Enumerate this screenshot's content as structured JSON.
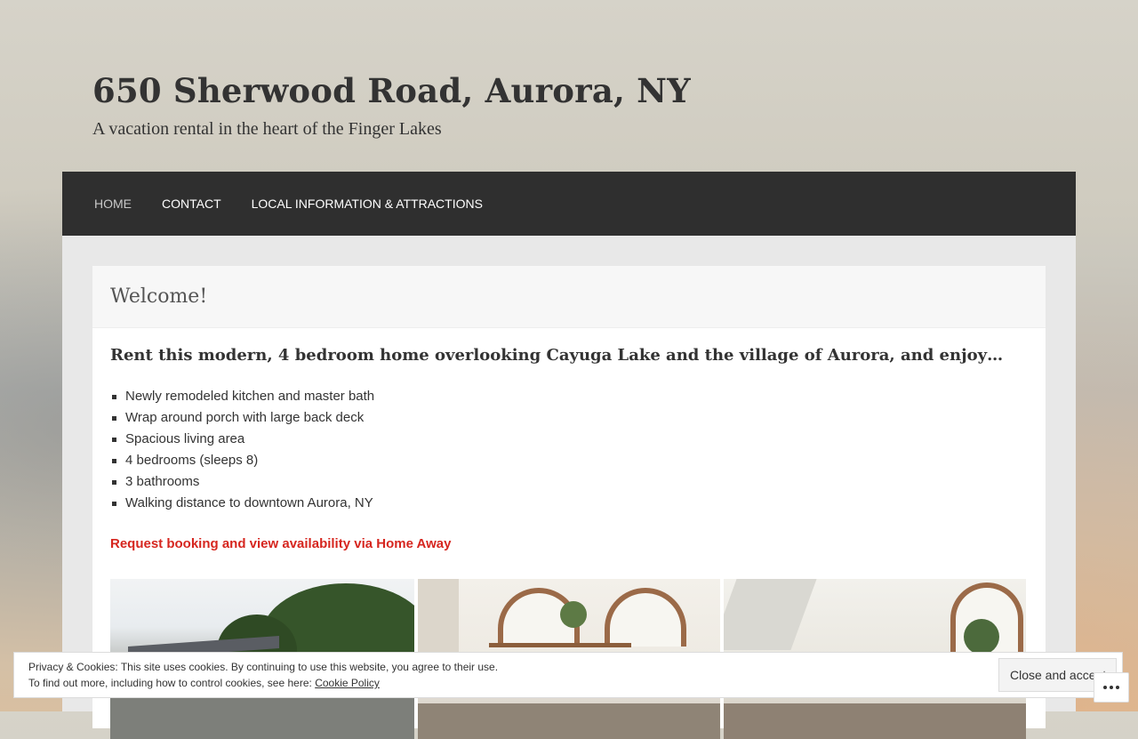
{
  "site": {
    "title": "650 Sherwood Road, Aurora, NY",
    "tagline": "A vacation rental in the heart of the Finger Lakes"
  },
  "nav": {
    "items": [
      {
        "label": "HOME"
      },
      {
        "label": "CONTACT"
      },
      {
        "label": "LOCAL INFORMATION & ATTRACTIONS"
      }
    ]
  },
  "post": {
    "title": "Welcome!",
    "lead": "Rent this modern, 4 bedroom home overlooking Cayuga Lake and the village of Aurora, and enjoy…",
    "features": [
      "Newly remodeled kitchen and master bath",
      "Wrap around porch with large back deck",
      "Spacious living area",
      "4 bedrooms (sleeps 8)",
      "3 bathrooms",
      "Walking distance to downtown Aurora, NY"
    ],
    "booking_link": "Request booking and view availability via Home Away"
  },
  "cookie": {
    "line1": "Privacy & Cookies: This site uses cookies. By continuing to use this website, you agree to their use.",
    "line2_prefix": "To find out more, including how to control cookies, see here:",
    "policy_link": "Cookie Policy",
    "button": "Close and accept"
  },
  "colors": {
    "nav_bg": "#2f2f2f",
    "link_red": "#d6261f"
  }
}
